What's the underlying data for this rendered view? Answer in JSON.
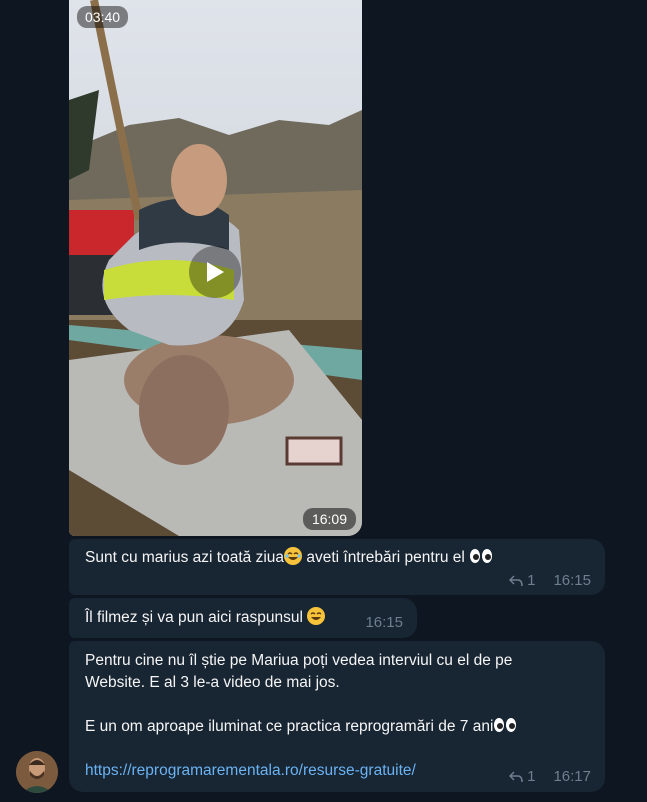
{
  "video": {
    "duration": "03:40",
    "time": "16:09"
  },
  "messages": [
    {
      "text_before": "Sunt cu marius azi toată ziua",
      "text_after": " aveti întrebări pentru el ",
      "replies": "1",
      "time": "16:15"
    },
    {
      "text": "Îl filmez și va pun aici raspunsul ",
      "time": "16:15"
    },
    {
      "line1": "Pentru cine nu îl știe pe Mariua poți vedea interviul cu el de pe",
      "line2": "Website. E al 3 le-a video de mai jos.",
      "line3": "E un om aproape iluminat ce practica reprogramări de 7 ani",
      "link": "https://reprogramarementala.ro/resurse-gratuite/",
      "replies": "1",
      "time": "16:17"
    }
  ],
  "colors": {
    "background": "#0e1621",
    "bubble": "#182533",
    "link": "#6ab3f3",
    "meta": "#6d7f8f"
  }
}
